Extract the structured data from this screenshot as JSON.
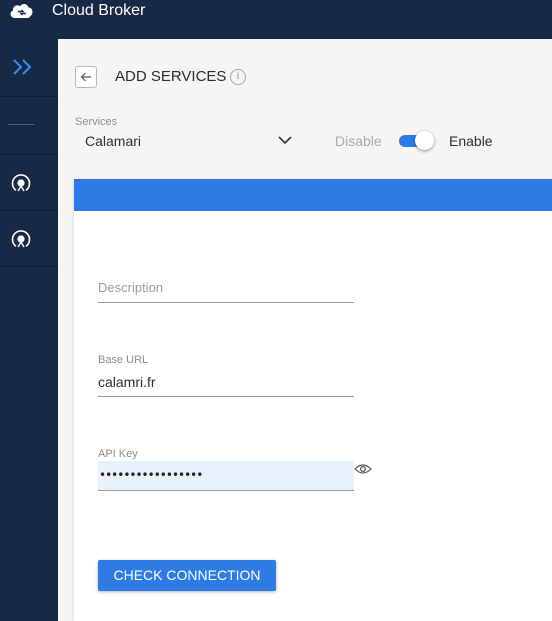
{
  "app": {
    "title": "Cloud Broker"
  },
  "sidebar": {
    "expand_icon": "double-chevron-right-icon",
    "items": [
      {
        "icon": "service-icon"
      },
      {
        "icon": "service-icon"
      }
    ]
  },
  "header": {
    "title": "ADD SERVICES",
    "info_glyph": "i"
  },
  "services": {
    "label": "Services",
    "value": "Calamari",
    "disable_label": "Disable",
    "enable_label": "Enable",
    "enabled": true
  },
  "form": {
    "description": {
      "placeholder": "Description",
      "value": ""
    },
    "base_url": {
      "label": "Base URL",
      "value": "calamri.fr"
    },
    "api_key": {
      "label": "API Key",
      "masked": "•••••••••••••••••"
    },
    "check_button": "CHECK CONNECTION"
  },
  "colors": {
    "primary": "#2f7be5",
    "sidebar": "#172a45",
    "background": "#f6f5f3"
  }
}
